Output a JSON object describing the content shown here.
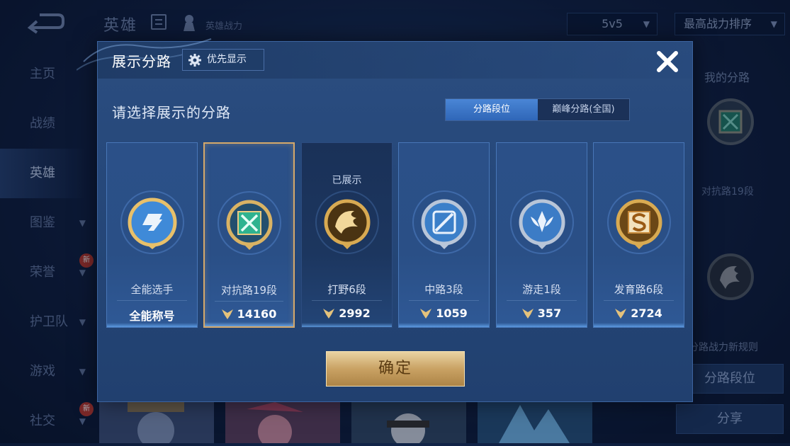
{
  "header": {
    "title": "英雄",
    "subtitle": "英雄战力",
    "mode_select": "5v5",
    "sort_select": "最高战力排序"
  },
  "sidebar": {
    "items": [
      {
        "label": "主页"
      },
      {
        "label": "战绩"
      },
      {
        "label": "英雄"
      },
      {
        "label": "图鉴"
      },
      {
        "label": "荣誉",
        "badge": "新"
      },
      {
        "label": "护卫队"
      },
      {
        "label": "游戏"
      },
      {
        "label": "社交",
        "badge": "新"
      }
    ]
  },
  "right_panel": {
    "title": "我的分路",
    "lane": "对抗路19段",
    "rule_text": "分路战力新规则",
    "lane_rank_button": "分路段位",
    "share_button": "分享"
  },
  "dialog": {
    "title": "展示分路",
    "priority_button": "优先显示",
    "prompt": "请选择展示的分路",
    "segments": [
      "分路段位",
      "巅峰分路(全国)"
    ],
    "cards": [
      {
        "name": "全能选手",
        "value": "全能称号",
        "shown_tag": "",
        "medal": "allround-medal-icon",
        "ring": "#e8c06a",
        "inner": "#3f8ad8"
      },
      {
        "name": "对抗路19段",
        "value": "14160",
        "shown_tag": "",
        "medal": "clash-lane-medal-icon",
        "ring": "#d9b364",
        "inner": "#2fb38f"
      },
      {
        "name": "打野6段",
        "value": "2992",
        "shown_tag": "已展示",
        "medal": "jungle-medal-icon",
        "ring": "#d8aa52",
        "inner": "#8a5a1e"
      },
      {
        "name": "中路3段",
        "value": "1059",
        "shown_tag": "",
        "medal": "mid-lane-medal-icon",
        "ring": "#b9c6d9",
        "inner": "#3b7fc9"
      },
      {
        "name": "游走1段",
        "value": "357",
        "shown_tag": "",
        "medal": "roam-medal-icon",
        "ring": "#b8c5d8",
        "inner": "#3c7cc6"
      },
      {
        "name": "发育路6段",
        "value": "2724",
        "shown_tag": "",
        "medal": "farm-lane-medal-icon",
        "ring": "#d8aa52",
        "inner": "#9a6a26"
      }
    ],
    "confirm_button": "确定"
  }
}
